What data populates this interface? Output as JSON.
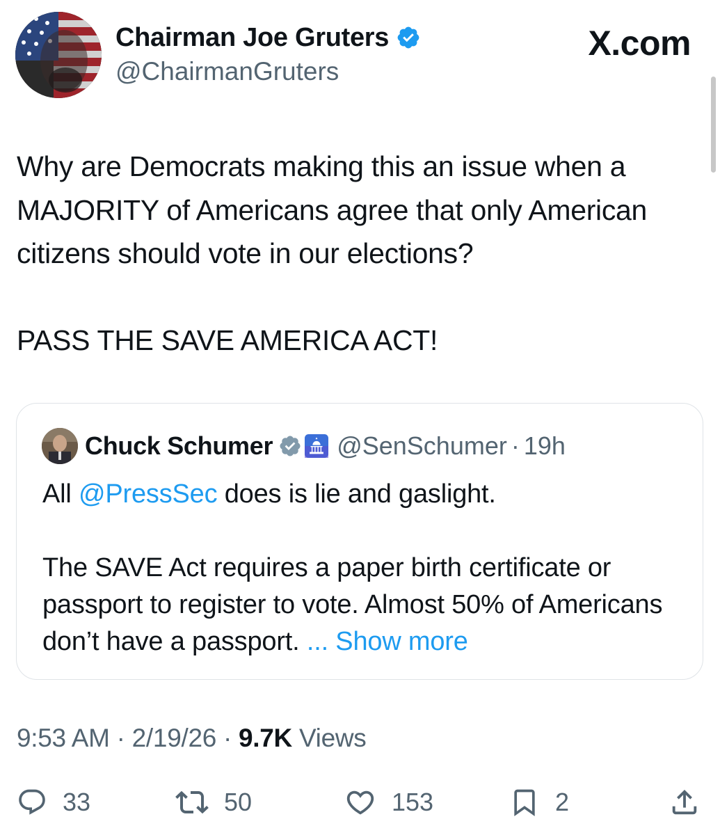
{
  "author": {
    "name": "Chairman Joe Gruters",
    "handle": "@ChairmanGruters",
    "verified": true
  },
  "watermark": "X.com",
  "tweet": {
    "text": "Why are Democrats making this an issue when a MAJORITY of Americans agree that only American citizens should vote in our elections?\n\nPASS THE SAVE AMERICA ACT!"
  },
  "quote": {
    "name": "Chuck Schumer",
    "handle": "@SenSchumer",
    "separator": "·",
    "time": "19h",
    "text_prefix": "All ",
    "mention": "@PressSec",
    "text_suffix": " does is lie and gaslight.",
    "paragraph2": "The SAVE Act requires a paper birth certificate or passport to register to vote. Almost 50% of Americans don’t have a passport.",
    "show_more": "... Show more"
  },
  "meta": {
    "time": "9:53 AM",
    "separator": "·",
    "date": "2/19/26",
    "views_count": "9.7K",
    "views_label": "Views"
  },
  "actions": {
    "replies": "33",
    "reposts": "50",
    "likes": "153",
    "bookmarks": "2"
  },
  "colors": {
    "text": "#0f1419",
    "secondary": "#536471",
    "link": "#1d9bf0",
    "verified_blue": "#1d9bf0",
    "verified_gray": "#829aab",
    "border": "#dfe3e7"
  },
  "icons": {
    "reply": "reply-icon",
    "repost": "repost-icon",
    "like": "heart-icon",
    "bookmark": "bookmark-icon",
    "share": "share-icon",
    "verified": "verified-badge-icon",
    "government": "capitol-badge-icon"
  }
}
